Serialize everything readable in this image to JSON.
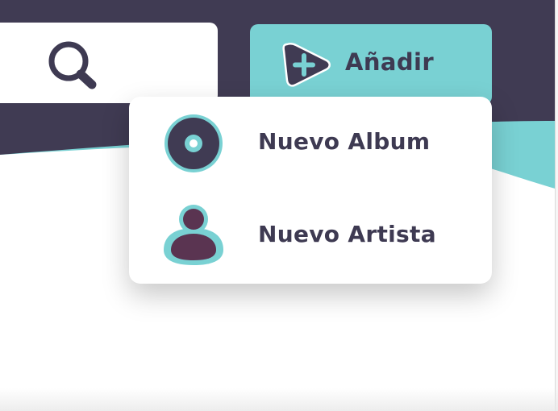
{
  "colors": {
    "header_bg": "#403b53",
    "accent_teal": "#79d1d3",
    "text_dark": "#3e3a52",
    "artist_fill": "#5a3451",
    "background": "#ffffff"
  },
  "search": {
    "icon": "search-icon"
  },
  "add_button": {
    "label": "Añadir",
    "icon": "play-plus-icon"
  },
  "dropdown": {
    "items": [
      {
        "label": "Nuevo Album",
        "icon": "album-disc-icon"
      },
      {
        "label": "Nuevo Artista",
        "icon": "artist-person-icon"
      }
    ]
  }
}
